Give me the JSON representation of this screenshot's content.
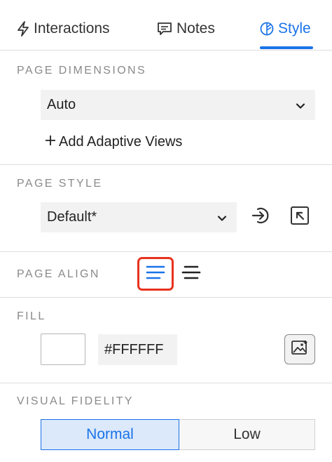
{
  "tabs": [
    {
      "label": "Interactions",
      "icon": "lightning-icon"
    },
    {
      "label": "Notes",
      "icon": "comment-icon"
    },
    {
      "label": "Style",
      "icon": "leaf-icon",
      "active": true
    }
  ],
  "accent_color": "#1a73e8",
  "selection_color": "#e8321e",
  "page_dimensions": {
    "title": "PAGE DIMENSIONS",
    "select_value": "Auto",
    "add_adaptive_label": "Add Adaptive Views"
  },
  "page_style": {
    "title": "PAGE STYLE",
    "select_value": "Default*"
  },
  "page_align": {
    "title": "PAGE ALIGN",
    "options": [
      "align-left",
      "align-center"
    ],
    "selected": "align-left"
  },
  "fill": {
    "title": "FILL",
    "hex_value": "#FFFFFF"
  },
  "visual_fidelity": {
    "title": "VISUAL FIDELITY",
    "options": [
      "Normal",
      "Low"
    ],
    "selected": "Normal"
  }
}
